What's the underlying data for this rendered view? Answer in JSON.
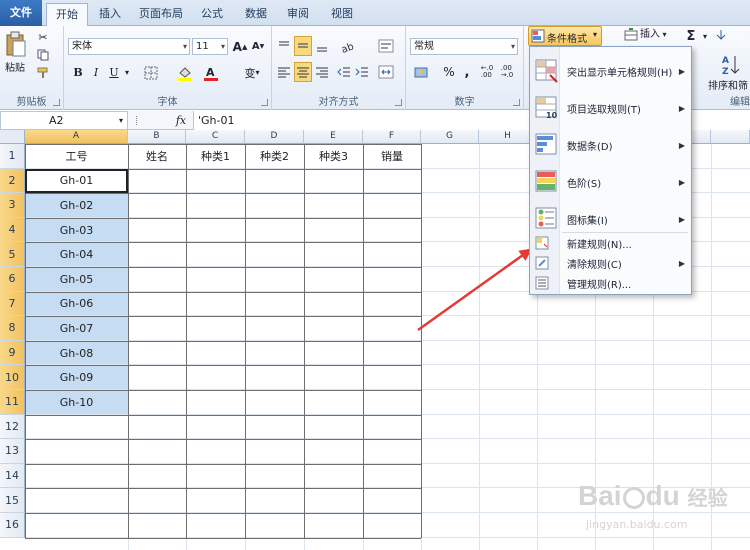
{
  "tabs": [
    "文件",
    "开始",
    "插入",
    "页面布局",
    "公式",
    "数据",
    "审阅",
    "视图"
  ],
  "ribbon": {
    "clipboard": {
      "paste_label": "粘贴",
      "group_label": "剪贴板"
    },
    "font": {
      "font_name": "宋体",
      "font_size": "11",
      "group_label": "字体",
      "bold": "B",
      "italic": "I",
      "underline": "U",
      "grow": "A",
      "shrink": "A",
      "wen": "变"
    },
    "alignment": {
      "group_label": "对齐方式"
    },
    "number": {
      "format": "常规",
      "group_label": "数字",
      "percent": "%",
      "comma": ","
    },
    "styles": {
      "conditional_format_label": "条件格式"
    },
    "cells": {
      "insert_label": "插入"
    },
    "editing": {
      "sigma": "Σ",
      "sort_label": "排序和筛",
      "edit_label": "编辑"
    }
  },
  "formula_bar": {
    "name_box": "A2",
    "fx": "fx",
    "value": "'Gh-01"
  },
  "grid": {
    "columns": [
      "A",
      "B",
      "C",
      "D",
      "E",
      "F",
      "G",
      "H"
    ],
    "rows": [
      "1",
      "2",
      "3",
      "4",
      "5",
      "6",
      "7",
      "8",
      "9",
      "10",
      "11",
      "12",
      "13",
      "14",
      "15",
      "16"
    ],
    "headers": [
      "工号",
      "姓名",
      "种类1",
      "种类2",
      "种类3",
      "销量"
    ],
    "ids": [
      "Gh-01",
      "Gh-02",
      "Gh-03",
      "Gh-04",
      "Gh-05",
      "Gh-06",
      "Gh-07",
      "Gh-08",
      "Gh-09",
      "Gh-10"
    ]
  },
  "menu": {
    "items": [
      {
        "label": "突出显示单元格规则(H)",
        "icon": "highlight-cells-icon",
        "has_submenu": true
      },
      {
        "label": "项目选取规则(T)",
        "icon": "top-bottom-icon",
        "has_submenu": true
      },
      {
        "label": "数据条(D)",
        "icon": "data-bars-icon",
        "has_submenu": true
      },
      {
        "label": "色阶(S)",
        "icon": "color-scales-icon",
        "has_submenu": true
      },
      {
        "label": "图标集(I)",
        "icon": "icon-sets-icon",
        "has_submenu": true
      },
      {
        "label": "新建规则(N)...",
        "icon": "new-rule-icon",
        "has_submenu": false
      },
      {
        "label": "清除规则(C)",
        "icon": "clear-rules-icon",
        "has_submenu": true
      },
      {
        "label": "管理规则(R)...",
        "icon": "manage-rules-icon",
        "has_submenu": false
      }
    ]
  },
  "annotation": {
    "arrow_color": "#e53935"
  },
  "watermark": {
    "brand": "Bai",
    "brand2": "du",
    "suffix": "经验",
    "url": "jingyan.baidu.com"
  },
  "colors": {
    "selection": "#c5dcf3",
    "header_selected": "#f1c15f",
    "file_tab": "#2a5ea6",
    "accent_blue": "#3d7ac5"
  }
}
